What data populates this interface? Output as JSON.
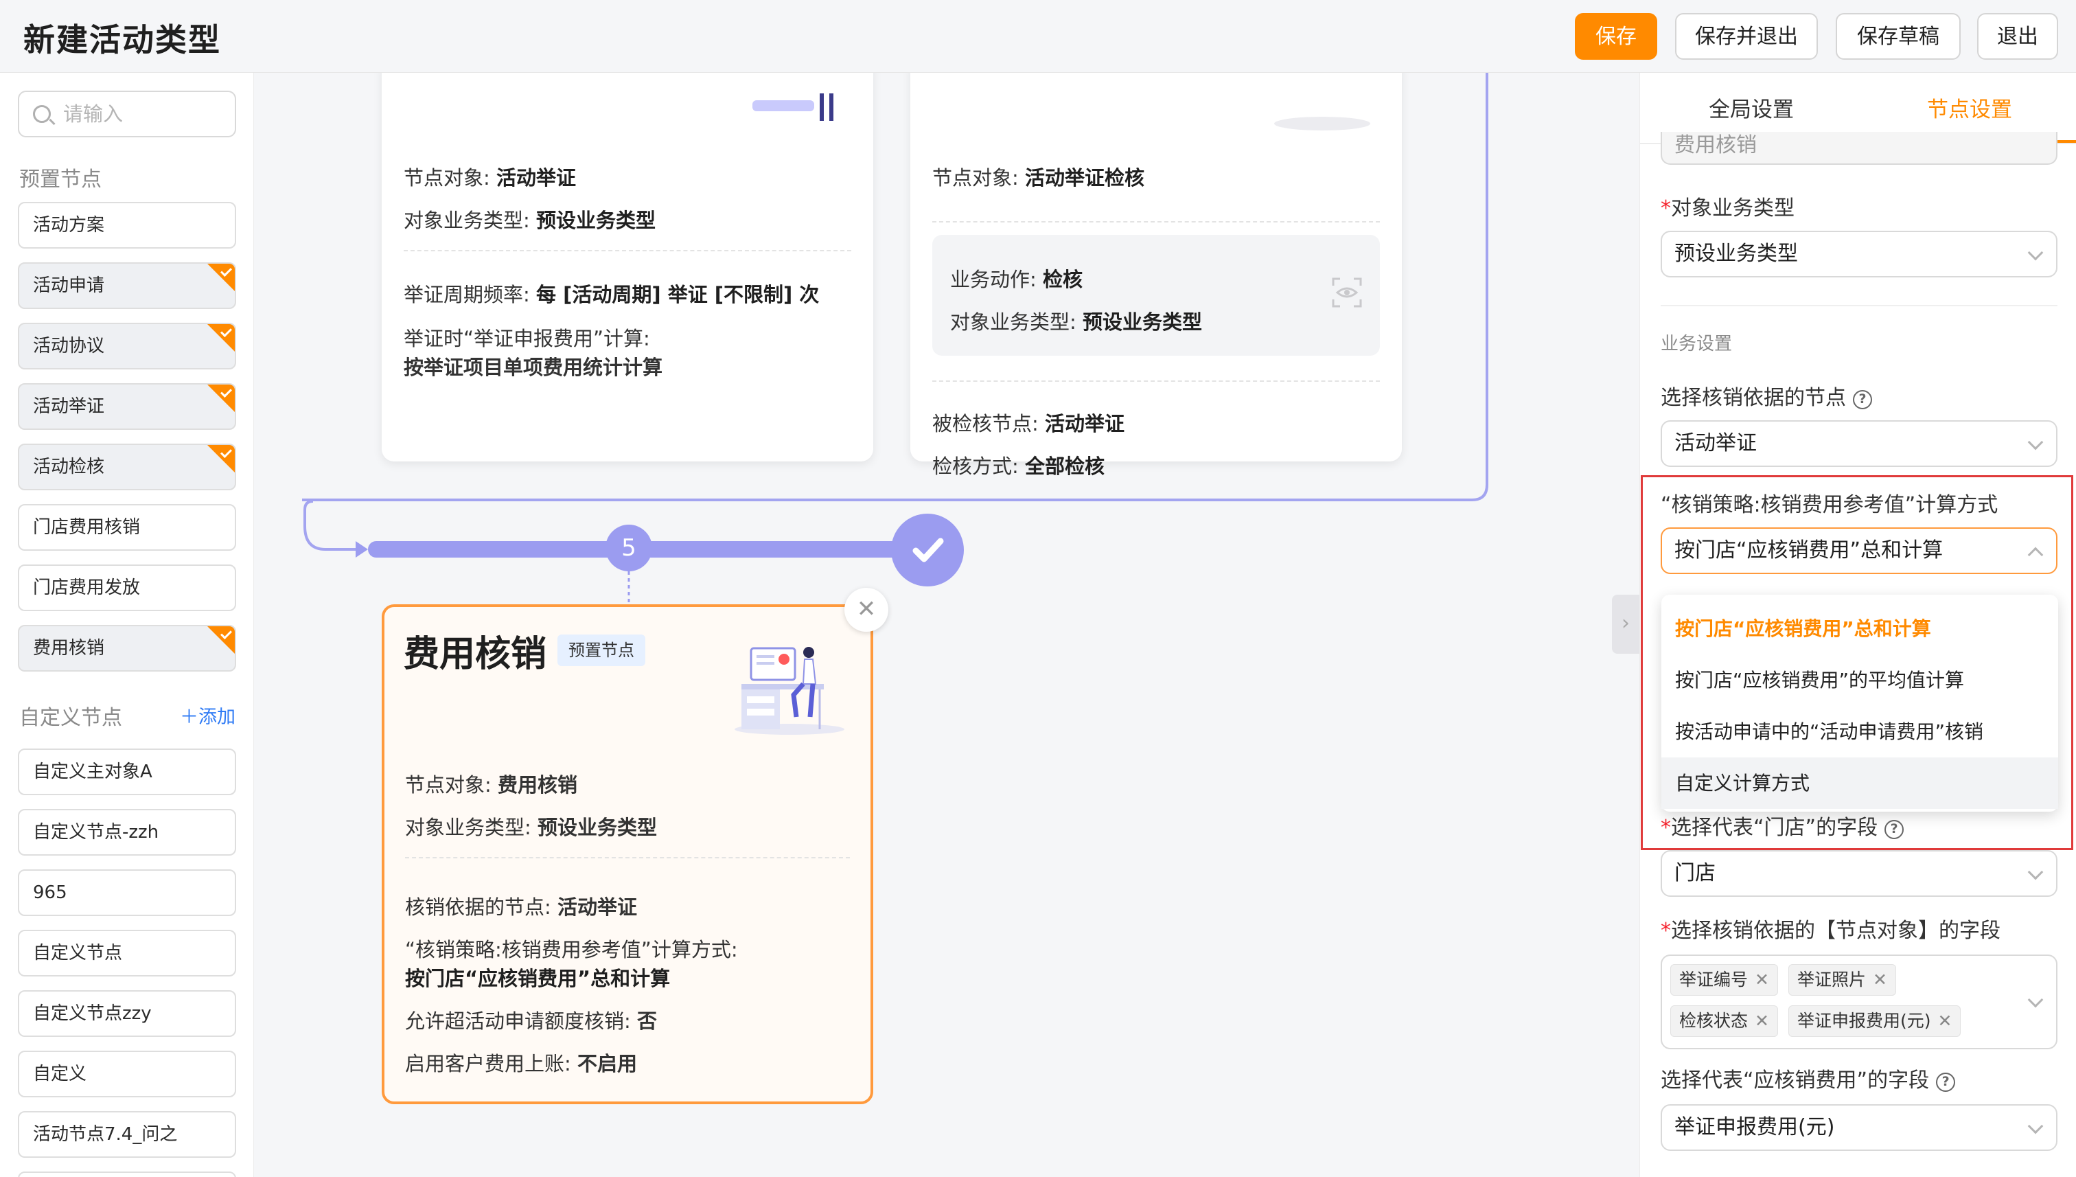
{
  "header": {
    "title": "新建活动类型",
    "buttons": {
      "save": "保存",
      "save_exit": "保存并退出",
      "save_draft": "保存草稿",
      "exit": "退出"
    }
  },
  "sidebar": {
    "search_placeholder": "请输入",
    "preset_title": "预置节点",
    "preset_nodes": [
      "活动方案",
      "活动申请",
      "活动协议",
      "活动举证",
      "活动检核",
      "门店费用核销",
      "门店费用发放",
      "费用核销"
    ],
    "custom_title": "自定义节点",
    "add_label": "＋添加",
    "custom_nodes": [
      "自定义主对象A",
      "自定义节点-zzh",
      "965",
      "自定义节点",
      "自定义节点zzy",
      "自定义",
      "活动节点7.4_问之"
    ]
  },
  "canvas": {
    "card_proof": {
      "node_object_label": "节点对象: ",
      "node_object_value": "活动举证",
      "biz_type_label": "对象业务类型: ",
      "biz_type_value": "预设业务类型",
      "freq_label": "举证周期频率: ",
      "freq_value": "每 [活动周期] 举证 [不限制] 次",
      "calc_label": "举证时“举证申报费用”计算:",
      "calc_value": "按举证项目单项费用统计计算"
    },
    "card_check": {
      "node_object_label": "节点对象: ",
      "node_object_value": "活动举证检核",
      "action_label": "业务动作: ",
      "action_value": "检核",
      "biz_type_label": "对象业务类型: ",
      "biz_type_value": "预设业务类型",
      "checked_node_label": "被检核节点: ",
      "checked_node_value": "活动举证",
      "method_label": "检核方式: ",
      "method_value": "全部检核"
    },
    "step_number": "5",
    "active_card": {
      "title": "费用核销",
      "tag": "预置节点",
      "node_object_label": "节点对象: ",
      "node_object_value": "费用核销",
      "biz_type_label": "对象业务类型: ",
      "biz_type_value": "预设业务类型",
      "basis_label": "核销依据的节点: ",
      "basis_value": "活动举证",
      "strategy_label": "“核销策略:核销费用参考值”计算方式:",
      "strategy_value": "按门店“应核销费用”总和计算",
      "over_label": "允许超活动申请额度核销: ",
      "over_value": "否",
      "ledger_label": "启用客户费用上账: ",
      "ledger_value": "不启用"
    }
  },
  "right_panel": {
    "tabs": [
      "全局设置",
      "节点设置"
    ],
    "active_tab": 1,
    "top_field_value": "费用核销",
    "biz_type_label": "对象业务类型",
    "biz_type_value": "预设业务类型",
    "biz_section": "业务设置",
    "basis_node_label": "选择核销依据的节点",
    "basis_node_value": "活动举证",
    "strategy_label": "“核销策略:核销费用参考值”计算方式",
    "strategy_value": "按门店“应核销费用”总和计算",
    "strategy_options": [
      "按门店“应核销费用”总和计算",
      "按门店“应核销费用”的平均值计算",
      "按活动申请中的“活动申请费用”核销",
      "自定义计算方式"
    ],
    "store_field_label": "选择代表“门店”的字段",
    "store_field_value": "门店",
    "basis_fields_label": "选择核销依据的【节点对象】的字段",
    "basis_fields_tags": [
      "举证编号",
      "举证照片",
      "检核状态",
      "举证申报费用(元)"
    ],
    "expense_field_label": "选择代表“应核销费用”的字段",
    "expense_field_value": "举证申报费用(元)",
    "help_glyph": "?",
    "required_mark": "*"
  },
  "colors": {
    "accent": "#ff8a00",
    "flow": "#9b9cf0",
    "highlight": "#e03a3a"
  }
}
